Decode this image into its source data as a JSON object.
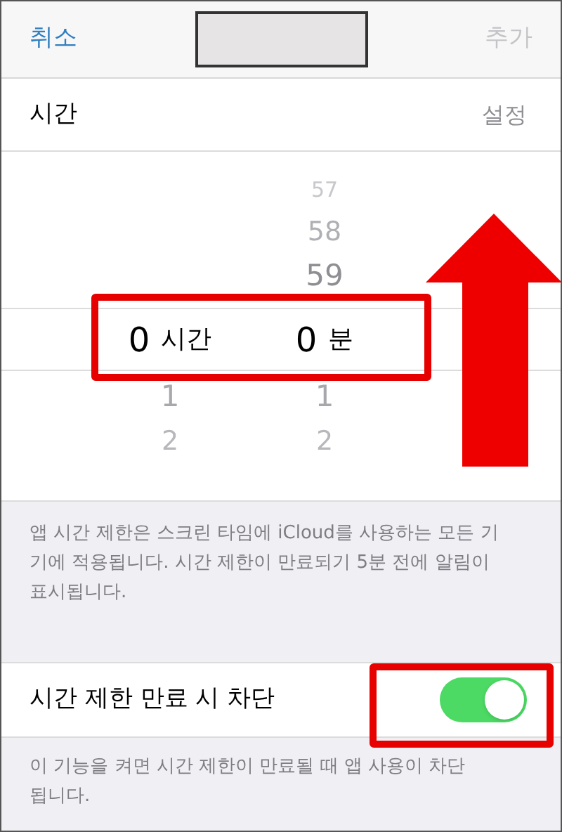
{
  "nav": {
    "cancel": "취소",
    "add": "추가",
    "add_disabled": true
  },
  "time_row": {
    "label": "시간",
    "value": "설정"
  },
  "picker": {
    "columns": [
      {
        "unit": "시간",
        "value": "0",
        "below": [
          "1",
          "2"
        ]
      },
      {
        "unit": "분",
        "above": [
          "57",
          "58",
          "59"
        ],
        "value": "0",
        "below": [
          "1",
          "2"
        ]
      }
    ]
  },
  "note": "앱 시간 제한은 스크린 타임에 iCloud를 사용하는 모든 기기에 적용됩니다. 시간 제한이 만료되기 5분 전에 알림이 표시됩니다.",
  "block_row": {
    "label": "시간 제한 만료 시 차단",
    "on": true
  },
  "block_note": "이 기능을 켜면 시간 제한이 만료될 때 앱 사용이 차단됩니다.",
  "annotations": {
    "picker_highlight": true,
    "toggle_highlight": true,
    "up_arrow": true
  }
}
